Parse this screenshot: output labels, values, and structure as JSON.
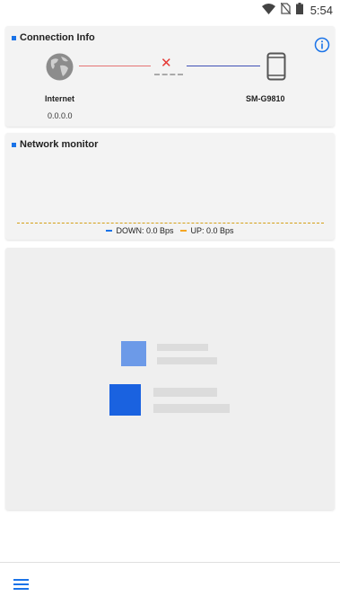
{
  "status_bar": {
    "time": "5:54",
    "icons": [
      "wifi-icon",
      "no-sim-icon",
      "battery-icon"
    ]
  },
  "connection_info": {
    "title": "Connection Info",
    "internet_label": "Internet",
    "ip_address": "0.0.0.0",
    "device_name": "SM-G9810",
    "status_mark": "✕",
    "icons": [
      "globe-icon",
      "phone-icon",
      "info-icon",
      "disconnected-icon"
    ]
  },
  "network_monitor": {
    "title": "Network monitor",
    "legend": {
      "down": "DOWN: 0.0 Bps",
      "up": "UP: 0.0 Bps"
    },
    "colors": {
      "down": "#1a73e8",
      "up": "#f5a623"
    }
  },
  "colors": {
    "accent": "#1a73e8",
    "error": "#e53935"
  },
  "bottom_bar": {
    "icons": [
      "menu-icon"
    ]
  }
}
